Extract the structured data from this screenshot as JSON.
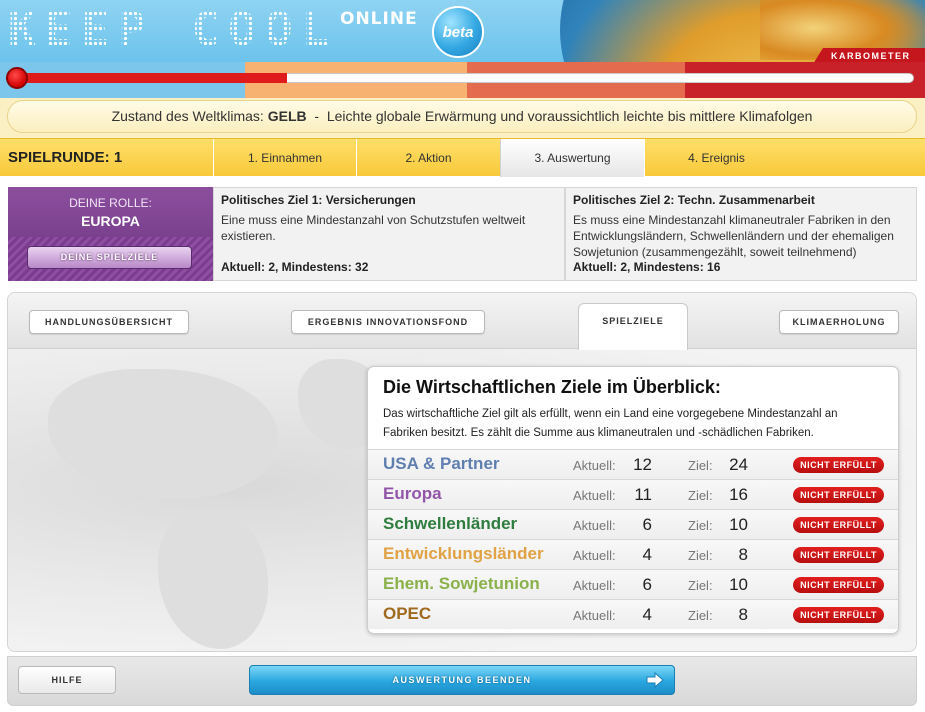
{
  "header": {
    "logo": "KEEP COOL",
    "online": "ONLINE",
    "beta": "beta",
    "karbometer": "KARBOMETER"
  },
  "karbometer": {
    "level": 0.31,
    "segment_colors": [
      "#7cc6ec",
      "#fde9a6",
      "#f7b272",
      "#e56b4f",
      "#c8212a"
    ]
  },
  "status": {
    "prefix": "Zustand des Weltklimas:",
    "level": "GELB",
    "separator": "-",
    "description": "Leichte globale Erwärmung und voraussichtlich leichte bis mittlere Klimafolgen"
  },
  "round": {
    "label": "SPIELRUNDE: 1",
    "steps": [
      {
        "label": "1. Einnahmen",
        "active": false
      },
      {
        "label": "2. Aktion",
        "active": false
      },
      {
        "label": "3. Auswertung",
        "active": true
      },
      {
        "label": "4. Ereignis",
        "active": false
      }
    ]
  },
  "role": {
    "title": "DEINE ROLLE:",
    "name": "EUROPA",
    "button": "DEINE SPIELZIELE"
  },
  "political_goals": [
    {
      "title": "Politisches Ziel 1: Versicherungen",
      "text": "Eine muss eine Mindestanzahl von Schutzstufen weltweit existieren.",
      "current": "Aktuell: 2, Mindestens: 32"
    },
    {
      "title": "Politisches Ziel 2: Techn. Zusammenarbeit",
      "text": "Es muss eine Mindestanzahl klimaneutraler Fabriken in den Entwicklungsländern, Schwellenländern und der ehemaligen Sowjetunion (zusammengezählt, soweit teilnehmend)",
      "current": "Aktuell: 2, Mindestens: 16"
    }
  ],
  "tabs": {
    "overview": "HANDLUNGSÜBERSICHT",
    "fund": "ERGEBNIS INNOVATIONSFOND",
    "goals": "SPIELZIELE",
    "recovery": "KLIMAERHOLUNG"
  },
  "economic": {
    "title": "Die Wirtschaftlichen Ziele im Überblick:",
    "description": "Das wirtschaftliche Ziel gilt als erfüllt, wenn ein Land eine vorgegebene Mindestanzahl an Fabriken besitzt. Es zählt die Summe aus klimaneutralen und -schädlichen Fabriken.",
    "current_label": "Aktuell:",
    "target_label": "Ziel:",
    "rows": [
      {
        "name": "USA & Partner",
        "color": "#5f7fb0",
        "current": "12",
        "target": "24",
        "status": "NICHT ERFÜLLT"
      },
      {
        "name": "Europa",
        "color": "#9255a8",
        "current": "11",
        "target": "16",
        "status": "NICHT ERFÜLLT"
      },
      {
        "name": "Schwellenländer",
        "color": "#2e7d3f",
        "current": "6",
        "target": "10",
        "status": "NICHT ERFÜLLT"
      },
      {
        "name": "Entwicklungsländer",
        "color": "#e0a244",
        "current": "4",
        "target": "8",
        "status": "NICHT ERFÜLLT"
      },
      {
        "name": "Ehem. Sowjetunion",
        "color": "#8ab14a",
        "current": "6",
        "target": "10",
        "status": "NICHT ERFÜLLT"
      },
      {
        "name": "OPEC",
        "color": "#a06a1e",
        "current": "4",
        "target": "8",
        "status": "NICHT ERFÜLLT"
      }
    ]
  },
  "footer": {
    "help": "HILFE",
    "end": "AUSWERTUNG BEENDEN"
  }
}
